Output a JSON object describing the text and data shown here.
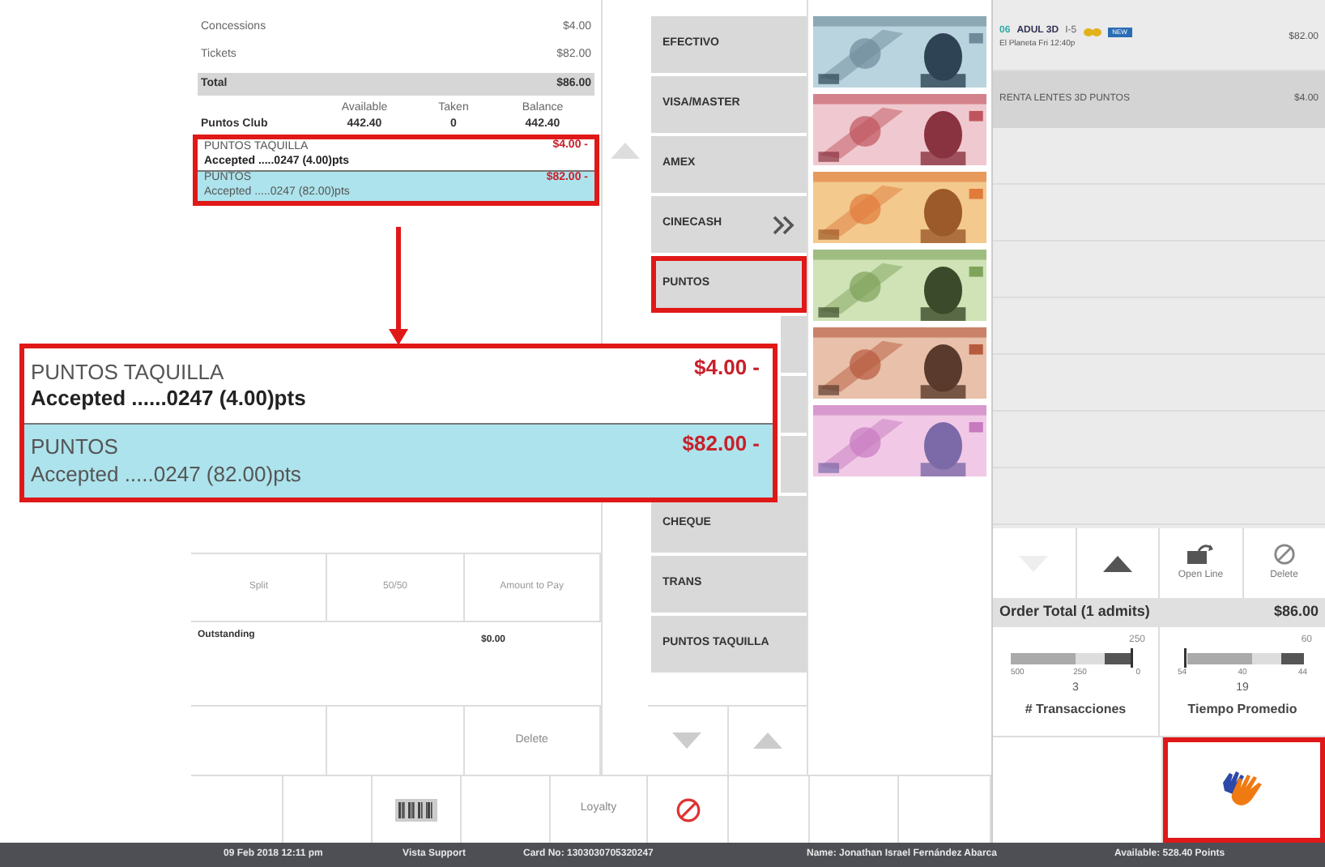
{
  "summary": {
    "lines": [
      {
        "label": "Concessions",
        "amount": "$4.00"
      },
      {
        "label": "Tickets",
        "amount": "$82.00"
      }
    ],
    "total": {
      "label": "Total",
      "amount": "$86.00"
    },
    "columns": [
      "Available",
      "Taken",
      "Balance"
    ],
    "club": {
      "name": "Puntos Club",
      "available": "442.40",
      "taken": "0",
      "balance": "442.40"
    },
    "payments": [
      {
        "name": "PUNTOS TAQUILLA",
        "detail": "Accepted .....0247  (4.00)pts",
        "amount": "$4.00 -",
        "selected": false
      },
      {
        "name": "PUNTOS",
        "detail": "Accepted .....0247  (82.00)pts",
        "amount": "$82.00 -",
        "selected": true
      }
    ]
  },
  "split_buttons": [
    "Split",
    "50/50",
    "Amount to Pay"
  ],
  "outstanding": {
    "label": "Outstanding",
    "amount": "$0.00"
  },
  "action_buttons": [
    {
      "kind": "blank"
    },
    {
      "kind": "blank"
    },
    {
      "kind": "text",
      "label": "Delete"
    }
  ],
  "bottom_buttons": [
    {
      "kind": "blank"
    },
    {
      "kind": "blank"
    },
    {
      "kind": "barcode"
    },
    {
      "kind": "blank"
    },
    {
      "kind": "text",
      "label": "Loyalty"
    },
    {
      "kind": "cancel"
    },
    {
      "kind": "blank"
    },
    {
      "kind": "blank"
    },
    {
      "kind": "blank"
    }
  ],
  "payment_methods": [
    {
      "kind": "text",
      "label": "EFECTIVO",
      "highlighted": false
    },
    {
      "kind": "text",
      "label": "VISA/MASTER",
      "highlighted": false
    },
    {
      "kind": "text",
      "label": "AMEX",
      "highlighted": false
    },
    {
      "kind": "more",
      "label": "CINECASH",
      "highlighted": false
    },
    {
      "kind": "text",
      "label": "PUNTOS",
      "highlighted": true
    },
    {
      "kind": "blank"
    },
    {
      "kind": "blank"
    },
    {
      "kind": "blank"
    },
    {
      "kind": "text",
      "label": "CHEQUE",
      "highlighted": false
    },
    {
      "kind": "text",
      "label": "TRANS",
      "highlighted": false
    },
    {
      "kind": "text",
      "label": "PUNTOS TAQUILLA",
      "highlighted": false
    }
  ],
  "banknotes": [
    {
      "kind": "picture"
    },
    {
      "kind": "picture"
    },
    {
      "kind": "picture"
    },
    {
      "kind": "picture"
    },
    {
      "kind": "picture"
    },
    {
      "kind": "picture"
    }
  ],
  "callout": {
    "rows": [
      {
        "name": "PUNTOS TAQUILLA",
        "detail": "Accepted ......0247  (4.00)pts",
        "amount": "$4.00 -",
        "selected": false
      },
      {
        "name": "PUNTOS",
        "detail": "Accepted .....0247  (82.00)pts",
        "amount": "$82.00 -",
        "selected": true
      }
    ]
  },
  "order": {
    "items": [
      {
        "kind": "ticket",
        "code": "06",
        "title": "ADUL 3D",
        "rating": "I-5",
        "badge": "NEW",
        "subtitle": "El Planeta Fri 12:40p",
        "amount": "$82.00",
        "selected": false
      },
      {
        "kind": "plain",
        "title": "RENTA LENTES  3D PUNTOS",
        "amount": "$4.00",
        "selected": true
      }
    ],
    "controls": [
      {
        "kind": "down"
      },
      {
        "kind": "up"
      },
      {
        "kind": "open",
        "label": "Open Line"
      },
      {
        "kind": "delete",
        "label": "Delete"
      }
    ],
    "total_label": "Order Total (1 admits)",
    "total": "$86.00"
  },
  "gauges": [
    {
      "target": "250",
      "ticks": [
        "500",
        "250",
        "0"
      ],
      "value": "3",
      "label": "# Transacciones"
    },
    {
      "target": "60",
      "ticks": [
        "54",
        "40",
        "44"
      ],
      "value": "19",
      "label": "Tiempo Promedio"
    }
  ],
  "status_bar": [
    "09 Feb 2018 12:11 pm",
    "Vista Support",
    "Card No: 1303030705320247",
    "Name: Jonathan Israel Fernández Abarca",
    "Available: 528.40 Points"
  ]
}
